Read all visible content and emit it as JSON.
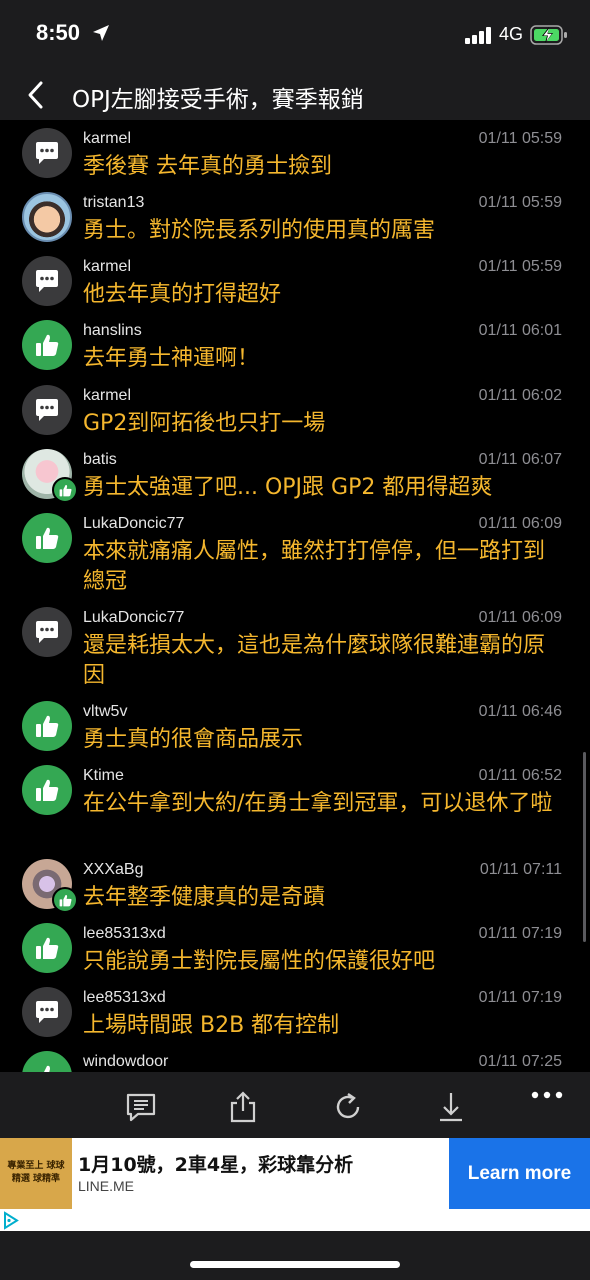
{
  "status_bar": {
    "time": "8:50",
    "network": "4G"
  },
  "nav": {
    "title": "OPJ左腳接受手術，賽季報銷"
  },
  "comments": [
    {
      "avatar": "message-icon",
      "user": "karmel",
      "time": "01/11 05:59",
      "text": "季後賽 去年真的勇士撿到"
    },
    {
      "avatar": "profile-photo",
      "user": "tristan13",
      "time": "01/11 05:59",
      "text": "勇士。對於院長系列的使用真的厲害"
    },
    {
      "avatar": "message-icon",
      "user": "karmel",
      "time": "01/11 05:59",
      "text": "他去年真的打得超好"
    },
    {
      "avatar": "thumbs-up-icon",
      "user": "hanslins",
      "time": "01/11 06:01",
      "text": "去年勇士神運啊！"
    },
    {
      "avatar": "message-icon",
      "user": "karmel",
      "time": "01/11 06:02",
      "text": "GP2到阿拓後也只打一場"
    },
    {
      "avatar": "profile-photo",
      "user": "batis",
      "time": "01/11 06:07",
      "text": "勇士太強運了吧... OPJ跟 GP2 都用得超爽"
    },
    {
      "avatar": "thumbs-up-icon",
      "user": "LukaDoncic77",
      "time": "01/11 06:09",
      "text": "本來就痛痛人屬性，雖然打打停停，但一路打到總冠"
    },
    {
      "avatar": "message-icon",
      "user": "LukaDoncic77",
      "time": "01/11 06:09",
      "text": "還是耗損太大，這也是為什麼球隊很難連霸的原因"
    },
    {
      "avatar": "thumbs-up-icon",
      "user": "vltw5v",
      "time": "01/11 06:46",
      "text": "勇士真的很會商品展示"
    },
    {
      "avatar": "thumbs-up-icon",
      "user": "Ktime",
      "time": "01/11 06:52",
      "text": "在公牛拿到大約/在勇士拿到冠軍，可以退休了啦"
    },
    {
      "avatar": "profile-photo",
      "user": "XXXaBg",
      "time": "01/11 07:11",
      "text": "去年整季健康真的是奇蹟"
    },
    {
      "avatar": "thumbs-up-icon",
      "user": "lee85313xd",
      "time": "01/11 07:19",
      "text": "只能說勇士對院長屬性的保護很好吧"
    },
    {
      "avatar": "message-icon",
      "user": "lee85313xd",
      "time": "01/11 07:19",
      "text": "上場時間跟 B2B 都有控制"
    },
    {
      "avatar": "thumbs-up-icon",
      "user": "windowdoor",
      "time": "01/11 07:25",
      "text": ""
    }
  ],
  "toolbar": [
    "reply-icon",
    "share-icon",
    "refresh-icon",
    "download-icon",
    "more-icon"
  ],
  "ad": {
    "thumb_text": "專業至上 球球精選 球精準",
    "title": "1月10號，2車4星，彩球靠分析",
    "domain": "LINE.ME",
    "cta": "Learn more"
  },
  "colors": {
    "accent_text": "#f5b72e",
    "like_green": "#34a853",
    "cta_blue": "#1a73e8"
  }
}
